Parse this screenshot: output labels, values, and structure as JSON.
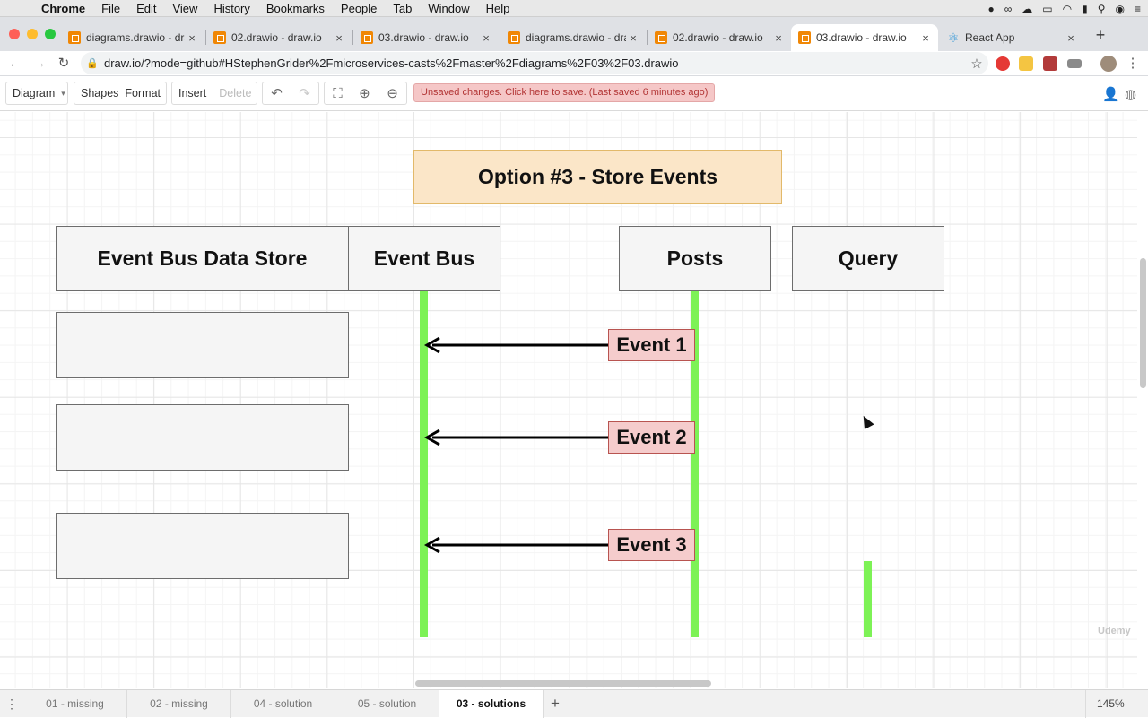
{
  "menubar": {
    "items": [
      "Chrome",
      "File",
      "Edit",
      "View",
      "History",
      "Bookmarks",
      "People",
      "Tab",
      "Window",
      "Help"
    ]
  },
  "tabs": [
    {
      "title": "diagrams.drawio - draw.io",
      "close": "×",
      "icon": "drawio-icon"
    },
    {
      "title": "02.drawio - draw.io",
      "close": "×",
      "icon": "drawio-icon"
    },
    {
      "title": "03.drawio - draw.io",
      "close": "×",
      "icon": "drawio-icon"
    },
    {
      "title": "diagrams.drawio - draw.io",
      "close": "×",
      "icon": "drawio-icon"
    },
    {
      "title": "02.drawio - draw.io",
      "close": "×",
      "icon": "drawio-icon"
    },
    {
      "title": "03.drawio - draw.io",
      "close": "×",
      "icon": "drawio-icon",
      "active": true
    },
    {
      "title": "React App",
      "close": "×",
      "icon": "react-icon"
    }
  ],
  "address": {
    "url": "draw.io/?mode=github#HStephenGrider%2Fmicroservices-casts%2Fmaster%2Fdiagrams%2F03%2F03.drawio"
  },
  "drawio_toolbar": {
    "diagram": "Diagram",
    "shapes": "Shapes",
    "format": "Format",
    "insert": "Insert",
    "delete": "Delete",
    "unsaved": "Unsaved changes. Click here to save. (Last saved 6 minutes ago)"
  },
  "diagram": {
    "title": "Option #3 - Store Events",
    "headers": [
      "Event Bus Data Store",
      "Event Bus",
      "Posts",
      "Query"
    ],
    "events": [
      "Event 1",
      "Event 2",
      "Event 3"
    ],
    "colors": {
      "title_fill": "#fbe6c8",
      "header_fill": "#f5f5f5",
      "event_fill": "#f5cccc",
      "lifeline": "#7df256"
    }
  },
  "pages": {
    "tabs": [
      "01 - missing",
      "02 - missing",
      "04 - solution",
      "05 - solution",
      "03 - solutions"
    ],
    "active": "03 - solutions",
    "add": "+",
    "zoom": "145%"
  },
  "watermark": "Udemy"
}
